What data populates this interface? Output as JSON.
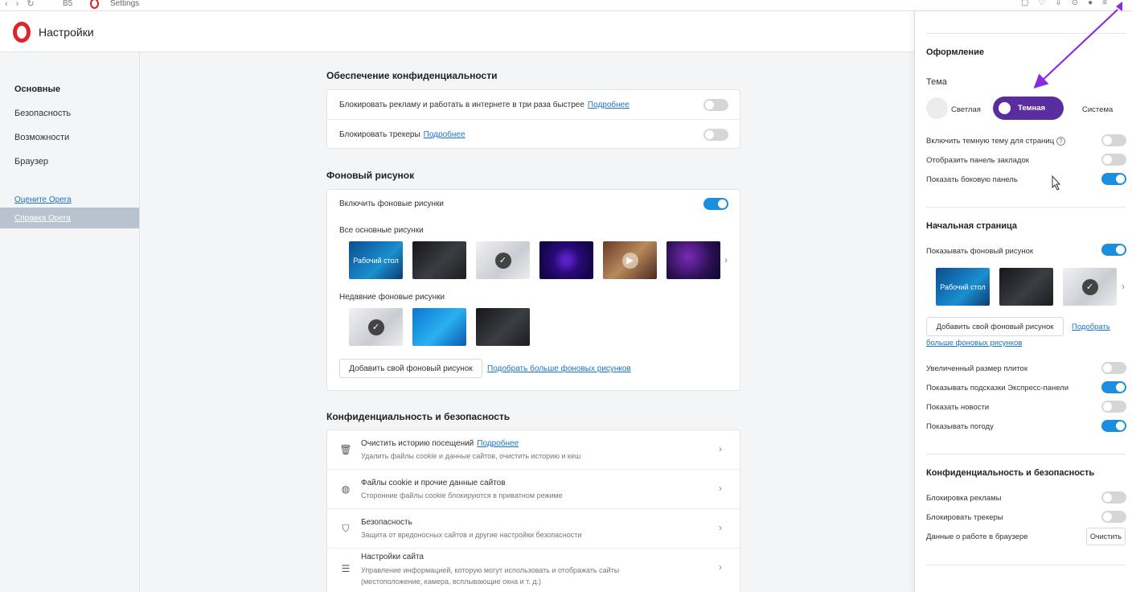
{
  "browser": {
    "tab_number": "B5",
    "tab_title": "Settings"
  },
  "header": {
    "title": "Настройки"
  },
  "sidebar": {
    "items": [
      {
        "label": "Основные",
        "active": true
      },
      {
        "label": "Безопасность"
      },
      {
        "label": "Возможности"
      },
      {
        "label": "Браузер"
      }
    ],
    "links": [
      {
        "label": "Оцените Opera"
      },
      {
        "label": "Справка Opera",
        "active": true
      }
    ]
  },
  "main": {
    "privacy": {
      "title": "Обеспечение конфиденциальности",
      "rows": [
        {
          "label": "Блокировать рекламу и работать в интернете в три раза быстрее",
          "link": "Подробнее",
          "on": false
        },
        {
          "label": "Блокировать трекеры",
          "link": "Подробнее",
          "on": false
        }
      ]
    },
    "wallpaper": {
      "title": "Фоновый рисунок",
      "enable_label": "Включить фоновые рисунки",
      "enable_on": true,
      "all_label": "Все основные рисунки",
      "all_thumbs": [
        {
          "label": "Рабочий стол",
          "style": "desk"
        },
        {
          "label": "",
          "style": "dark"
        },
        {
          "label": "",
          "style": "light",
          "checked": true
        },
        {
          "label": "",
          "style": "purple"
        },
        {
          "label": "",
          "style": "game"
        },
        {
          "label": "",
          "style": "space"
        }
      ],
      "recent_label": "Недавние фоновые рисунки",
      "recent_thumbs": [
        {
          "style": "light",
          "checked": true
        },
        {
          "style": "win"
        },
        {
          "style": "dark"
        }
      ],
      "add_button": "Добавить свой фоновый рисунок",
      "more_link": "Подобрать больше фоновых рисунков"
    },
    "security": {
      "title": "Конфиденциальность и безопасность",
      "rows": [
        {
          "icon": "trash-icon",
          "glyph": "🗑",
          "title": "Очистить историю посещений",
          "link": "Подробнее",
          "sub": "Удалить файлы cookie и данные сайтов, очистить историю и кеш"
        },
        {
          "icon": "cookie-icon",
          "glyph": "◍",
          "title": "Файлы cookie и прочие данные сайтов",
          "link": "",
          "sub": "Сторонние файлы cookie блокируются в приватном режиме"
        },
        {
          "icon": "shield-icon",
          "glyph": "⛉",
          "title": "Безопасность",
          "link": "",
          "sub": "Защита от вредоносных сайтов и другие настройки безопасности"
        },
        {
          "icon": "sliders-icon",
          "glyph": "☰",
          "title": "Настройки сайта",
          "link": "",
          "sub": "Управление информацией, которую могут использовать и отображать сайты (местоположение, камера, всплывающие окна и т. д.)"
        }
      ]
    }
  },
  "panel": {
    "appearance": {
      "title": "Оформление",
      "theme_label": "Тема",
      "theme_light": "Светлая",
      "theme_dark": "Темная",
      "theme_system": "Система",
      "toggles": [
        {
          "label": "Включить темную тему для страниц",
          "on": false,
          "help": true
        },
        {
          "label": "Отобразить панель закладок",
          "on": false
        },
        {
          "label": "Показать боковую панель",
          "on": true
        }
      ]
    },
    "start": {
      "title": "Начальная страница",
      "show_wallpaper": "Показывать фоновый рисунок",
      "show_wallpaper_on": true,
      "thumbs": [
        {
          "label": "Рабочий стол",
          "style": "desk"
        },
        {
          "label": "",
          "style": "dark"
        },
        {
          "label": "",
          "style": "light",
          "checked": true
        }
      ],
      "add_button": "Добавить свой фоновый рисунок",
      "more_link_1": "Подобрать",
      "more_link_2": "больше фоновых рисунков",
      "toggles": [
        {
          "label": "Увеличенный размер плиток",
          "on": false
        },
        {
          "label": "Показывать подсказки Экспресс-панели",
          "on": true
        },
        {
          "label": "Показать новости",
          "on": false
        },
        {
          "label": "Показывать погоду",
          "on": true
        }
      ]
    },
    "privacy": {
      "title": "Конфиденциальность и безопасность",
      "toggles": [
        {
          "label": "Блокировка рекламы",
          "on": false
        },
        {
          "label": "Блокировать трекеры",
          "on": false
        }
      ],
      "data_label": "Данные о работе в браузере",
      "clear_button": "Очистить"
    }
  },
  "colors": {
    "accent": "#1a8fdd",
    "opera_red": "#e1232c",
    "theme_purple": "#5a2d9e",
    "annotation_arrow": "#8a2be2"
  }
}
